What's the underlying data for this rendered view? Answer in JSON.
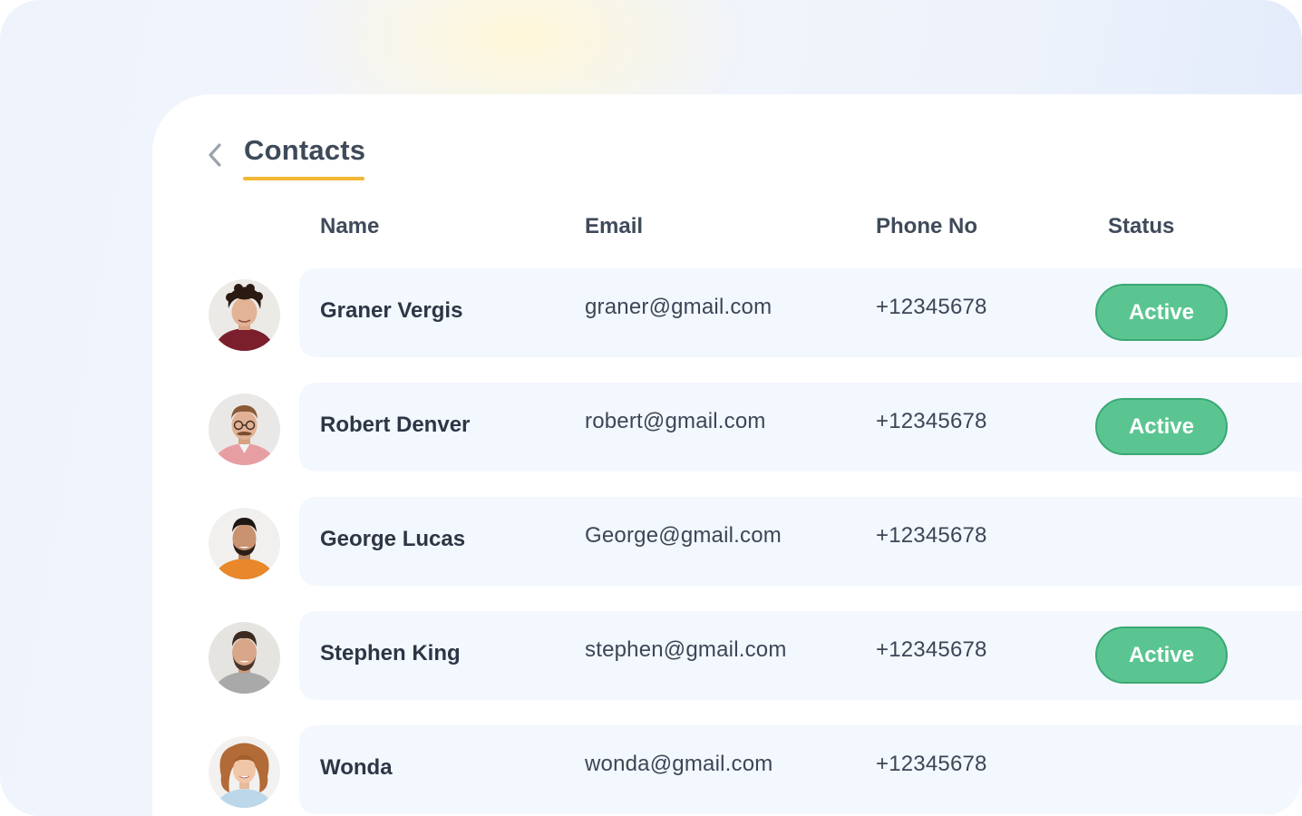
{
  "page": {
    "title": "Contacts",
    "back_icon": "chevron-left-icon",
    "accent_color": "#f4b736"
  },
  "table": {
    "headers": {
      "name": "Name",
      "email": "Email",
      "phone": "Phone No",
      "status": "Status"
    },
    "rows": [
      {
        "name": "Graner Vergis",
        "email": "graner@gmail.com",
        "phone": "+12345678",
        "status": "Active"
      },
      {
        "name": "Robert Denver",
        "email": "robert@gmail.com",
        "phone": "+12345678",
        "status": "Active"
      },
      {
        "name": "George Lucas",
        "email": "George@gmail.com",
        "phone": "+12345678",
        "status": ""
      },
      {
        "name": "Stephen King",
        "email": "stephen@gmail.com",
        "phone": "+12345678",
        "status": "Active"
      },
      {
        "name": "Wonda",
        "email": "wonda@gmail.com",
        "phone": "+12345678",
        "status": ""
      }
    ]
  },
  "colors": {
    "status_active": "#5bc592",
    "row_background": "#f3f7fe",
    "text_primary": "#2c3644"
  }
}
